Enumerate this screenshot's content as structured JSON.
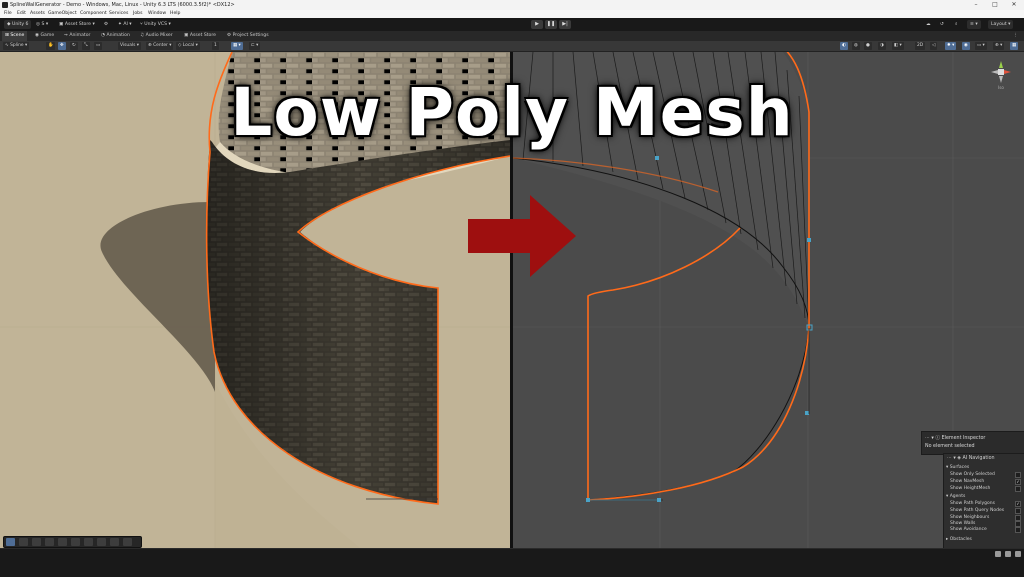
{
  "window": {
    "title": "SplineWallGenerator - Demo - Windows, Mac, Linux - Unity 6.3 LTS (6000.3.5f2)* <DX12>",
    "controls": [
      "–",
      "□",
      "✕"
    ]
  },
  "menu": [
    "File",
    "Edit",
    "Assets",
    "GameObject",
    "Component",
    "Services",
    "Jobs",
    "Window",
    "Help"
  ],
  "toolbar": {
    "unity_label": "Unity 6",
    "account_label": "S",
    "asset_store_label": "Asset Store",
    "ai_label": "AI",
    "vcs_label": "Unity VCS",
    "layout_label": "Layout"
  },
  "tabs": [
    "Scene",
    "Game",
    "Animator",
    "Animation",
    "Audio Mixer",
    "Asset Store",
    "Project Settings"
  ],
  "scene_toolbar": {
    "mode_label": "Spline",
    "visuals_label": "Visuals",
    "center_label": "Center",
    "local_label": "Local",
    "snap_value": "1"
  },
  "headline": "Low Poly Mesh",
  "gizmo": {
    "label": "Iso",
    "axis_y": "y",
    "axis_x": "x"
  },
  "element_inspector": {
    "title": "Element Inspector",
    "status": "No element selected"
  },
  "ai_navigation": {
    "title": "AI Navigation",
    "surfaces_heading": "Surfaces",
    "surface_options": [
      {
        "label": "Show Only Selected",
        "checked": false
      },
      {
        "label": "Show NavMesh",
        "checked": true
      },
      {
        "label": "Show HeightMesh",
        "checked": false
      }
    ],
    "agents_heading": "Agents",
    "agent_options": [
      {
        "label": "Show Path Polygons",
        "checked": true
      },
      {
        "label": "Show Path Query Nodes",
        "checked": false
      },
      {
        "label": "Show Neighbours",
        "checked": false
      },
      {
        "label": "Show Walls",
        "checked": false
      },
      {
        "label": "Show Avoidance",
        "checked": false
      }
    ],
    "obstacles_heading": "Obstacles"
  },
  "colors": {
    "outline": "#ff6a1a",
    "arrow": "#9e0f0f",
    "ground": "#c1b497",
    "scene_dark": "#4b4b4b",
    "accent": "#4f6d95"
  }
}
